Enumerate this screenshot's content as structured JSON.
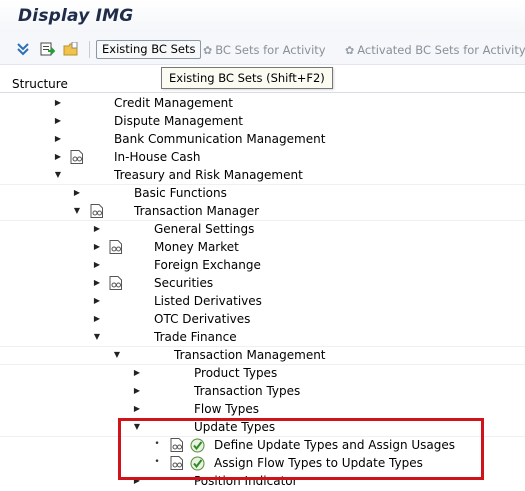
{
  "window": {
    "title": "Display IMG"
  },
  "toolbar": {
    "existing_bc_sets": "Existing BC Sets",
    "bc_sets_for_activity": "BC Sets for Activity",
    "activated_bc_sets_for_activity": "Activated BC Sets for Activity"
  },
  "tooltip": {
    "text": "Existing BC Sets    (Shift+F2)"
  },
  "structure": {
    "header": "Structure"
  },
  "tree": [
    {
      "label": "Credit Management"
    },
    {
      "label": "Dispute Management"
    },
    {
      "label": "Bank Communication Management"
    },
    {
      "label": "In-House Cash"
    },
    {
      "label": "Treasury and Risk Management"
    },
    {
      "label": "Basic Functions"
    },
    {
      "label": "Transaction Manager"
    },
    {
      "label": "General Settings"
    },
    {
      "label": "Money Market"
    },
    {
      "label": "Foreign Exchange"
    },
    {
      "label": "Securities"
    },
    {
      "label": "Listed Derivatives"
    },
    {
      "label": "OTC Derivatives"
    },
    {
      "label": "Trade Finance"
    },
    {
      "label": "Transaction Management"
    },
    {
      "label": "Product Types"
    },
    {
      "label": "Transaction Types"
    },
    {
      "label": "Flow Types"
    },
    {
      "label": "Update Types"
    },
    {
      "label": "Define Update Types and Assign Usages"
    },
    {
      "label": "Assign Flow Types to Update Types"
    },
    {
      "label": "Position Indicator"
    }
  ],
  "colors": {
    "highlight_box": "#d0121b",
    "title_text": "#1f2d4b"
  }
}
